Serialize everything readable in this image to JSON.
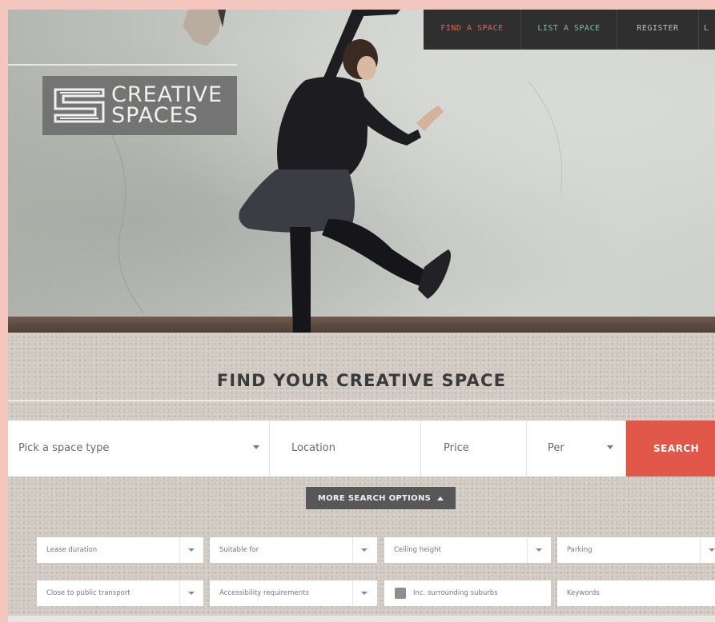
{
  "logo": {
    "line1": "CREATIVE",
    "line2": "SPACES"
  },
  "nav": {
    "items": [
      {
        "label": "FIND A SPACE"
      },
      {
        "label": "LIST A SPACE"
      },
      {
        "label": "REGISTER"
      },
      {
        "label": "L"
      }
    ]
  },
  "search": {
    "title": "FIND YOUR CREATIVE SPACE",
    "space_type": "Pick a space type",
    "location": "Location",
    "price": "Price",
    "per": "Per",
    "search_label": "SEARCH",
    "more_options_label": "MORE SEARCH OPTIONS"
  },
  "filters": {
    "lease_duration": "Lease duration",
    "suitable_for": "Suitable for",
    "ceiling_height": "Ceiling height",
    "parking": "Parking",
    "public_transport": "Close to public transport",
    "accessibility": "Accessibility requirements",
    "surrounding_suburbs": "Inc. surrounding suburbs",
    "keywords": "Keywords"
  },
  "colors": {
    "accent_red": "#e1574a",
    "nav_find": "#e0675a",
    "nav_list": "#7fbf9a",
    "nav_bg": "#2f2f2f"
  }
}
